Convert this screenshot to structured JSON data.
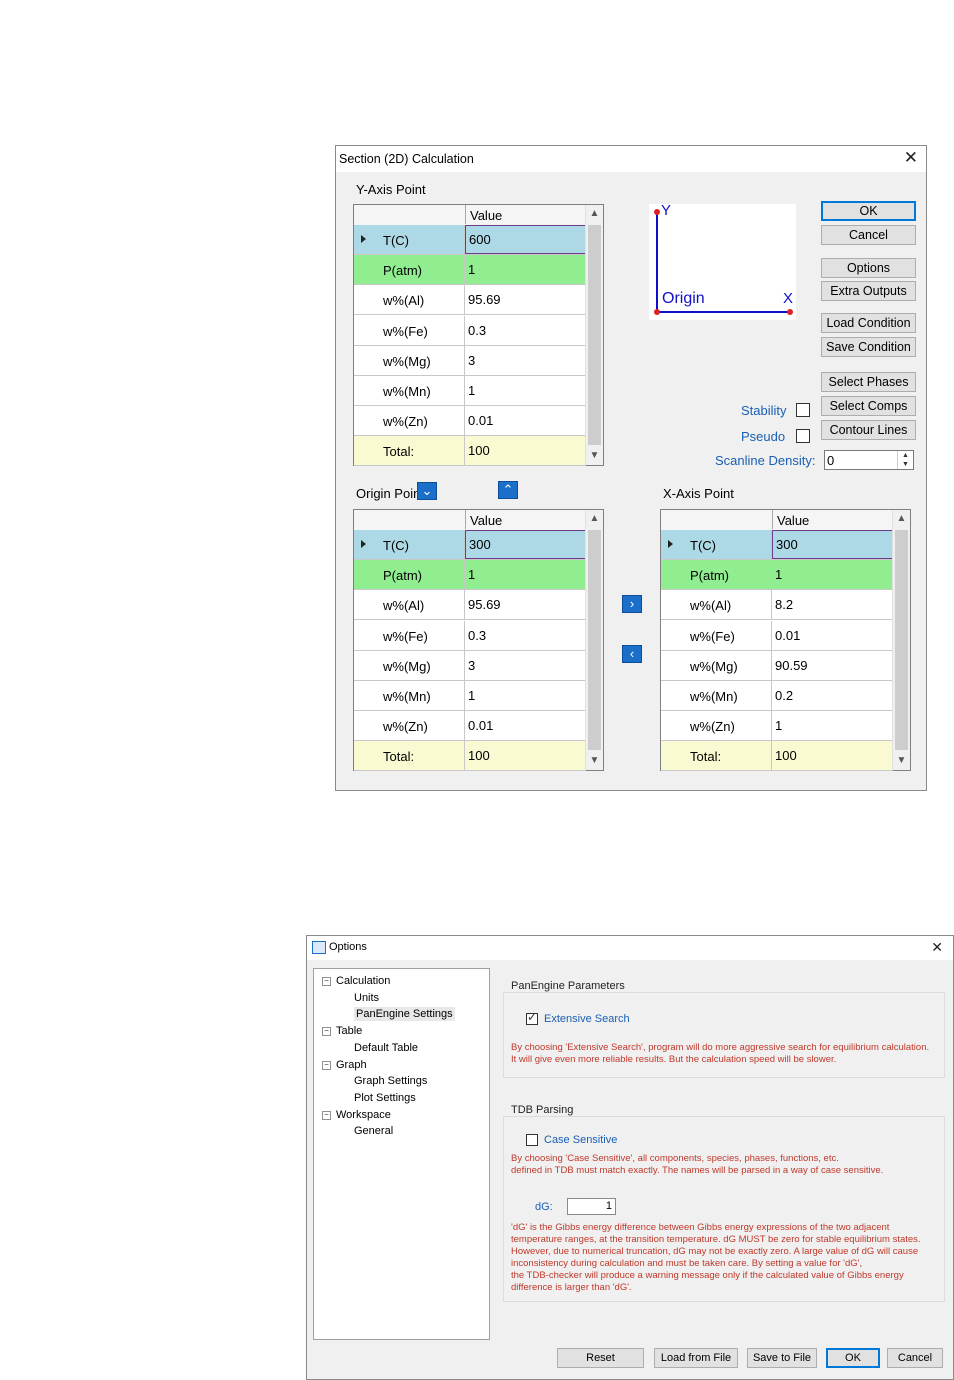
{
  "section_dialog": {
    "title": "Section (2D) Calculation",
    "y_axis_label": "Y-Axis Point",
    "origin_label": "Origin Point",
    "x_axis_label": "X-Axis Point",
    "value_header": "Value",
    "y_rows": [
      {
        "name": "T(C)",
        "value": "600"
      },
      {
        "name": "P(atm)",
        "value": "1"
      },
      {
        "name": "w%(Al)",
        "value": "95.69"
      },
      {
        "name": "w%(Fe)",
        "value": "0.3"
      },
      {
        "name": "w%(Mg)",
        "value": "3"
      },
      {
        "name": "w%(Mn)",
        "value": "1"
      },
      {
        "name": "w%(Zn)",
        "value": "0.01"
      },
      {
        "name": "Total:",
        "value": "100"
      }
    ],
    "origin_rows": [
      {
        "name": "T(C)",
        "value": "300"
      },
      {
        "name": "P(atm)",
        "value": "1"
      },
      {
        "name": "w%(Al)",
        "value": "95.69"
      },
      {
        "name": "w%(Fe)",
        "value": "0.3"
      },
      {
        "name": "w%(Mg)",
        "value": "3"
      },
      {
        "name": "w%(Mn)",
        "value": "1"
      },
      {
        "name": "w%(Zn)",
        "value": "0.01"
      },
      {
        "name": "Total:",
        "value": "100"
      }
    ],
    "x_rows": [
      {
        "name": "T(C)",
        "value": "300"
      },
      {
        "name": "P(atm)",
        "value": "1"
      },
      {
        "name": "w%(Al)",
        "value": "8.2"
      },
      {
        "name": "w%(Fe)",
        "value": "0.01"
      },
      {
        "name": "w%(Mg)",
        "value": "90.59"
      },
      {
        "name": "w%(Mn)",
        "value": "0.2"
      },
      {
        "name": "w%(Zn)",
        "value": "1"
      },
      {
        "name": "Total:",
        "value": "100"
      }
    ],
    "diagram": {
      "y": "Y",
      "x": "X",
      "origin": "Origin"
    },
    "buttons": {
      "ok": "OK",
      "cancel": "Cancel",
      "options": "Options",
      "extra_outputs": "Extra Outputs",
      "load_condition": "Load Condition",
      "save_condition": "Save Condition",
      "select_phases": "Select Phases",
      "select_comps": "Select Comps",
      "contour_lines": "Contour Lines"
    },
    "stability_label": "Stability",
    "pseudo_label": "Pseudo",
    "scanline_label": "Scanline Density:",
    "scanline_value": "0"
  },
  "options_dialog": {
    "title": "Options",
    "tree": [
      {
        "label": "Calculation",
        "level": 0
      },
      {
        "label": "Units",
        "level": 1
      },
      {
        "label": "PanEngine Settings",
        "level": 1
      },
      {
        "label": "Table",
        "level": 0
      },
      {
        "label": "Default Table",
        "level": 1
      },
      {
        "label": "Graph",
        "level": 0
      },
      {
        "label": "Graph Settings",
        "level": 1
      },
      {
        "label": "Plot Settings",
        "level": 1
      },
      {
        "label": "Workspace",
        "level": 0
      },
      {
        "label": "General",
        "level": 1
      }
    ],
    "panengine_title": "PanEngine Parameters",
    "extensive_label": "Extensive Search",
    "extensive_text": "By choosing 'Extensive Search', program will do more aggressive search for equilibrium calculation.\nIt will give even more reliable results. But the calculation speed will be slower.",
    "tdb_title": "TDB Parsing",
    "case_label": "Case Sensitive",
    "case_text": "By choosing 'Case Sensitive', all components, species, phases, functions, etc.\ndefined in TDB must match exactly. The names will be parsed in a way of case sensitive.",
    "dg_label": "dG:",
    "dg_value": "1",
    "dg_text": "'dG' is the Gibbs energy difference between Gibbs energy expressions of the two adjacent\ntemperature ranges, at the transition temperature. dG MUST be zero for stable equilibrium states.\nHowever, due to numerical truncation, dG may not be exactly zero. A large value of dG will cause\ninconsistency during calculation and must be taken care. By setting a value for 'dG',\nthe TDB-checker will produce a warning message only if the calculated value of Gibbs energy\ndifference is larger than 'dG'.",
    "buttons": {
      "reset": "Reset",
      "load": "Load from File",
      "save": "Save to File",
      "ok": "OK",
      "cancel": "Cancel"
    }
  },
  "colors": {
    "selected_row": "#add8e6",
    "pressure_row": "#90ee90",
    "total_row": "#fafad2",
    "accent": "#1a5fb4",
    "note": "#c0392b"
  }
}
